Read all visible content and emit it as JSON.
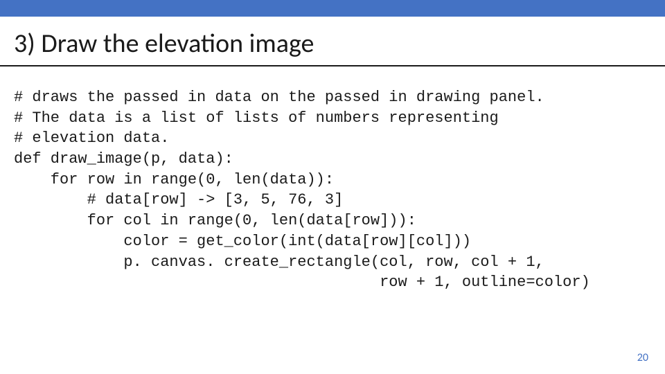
{
  "slide": {
    "title": "3) Draw the elevation image",
    "page_number": "20"
  },
  "code": {
    "lines": [
      "# draws the passed in data on the passed in drawing panel.",
      "# The data is a list of lists of numbers representing",
      "# elevation data.",
      "def draw_image(p, data):",
      "    for row in range(0, len(data)):",
      "        # data[row] -> [3, 5, 76, 3]",
      "        for col in range(0, len(data[row])):",
      "            color = get_color(int(data[row][col]))",
      "            p. canvas. create_rectangle(col, row, col + 1,",
      "                                        row + 1, outline=color)"
    ]
  },
  "colors": {
    "accent": "#4472c4"
  }
}
